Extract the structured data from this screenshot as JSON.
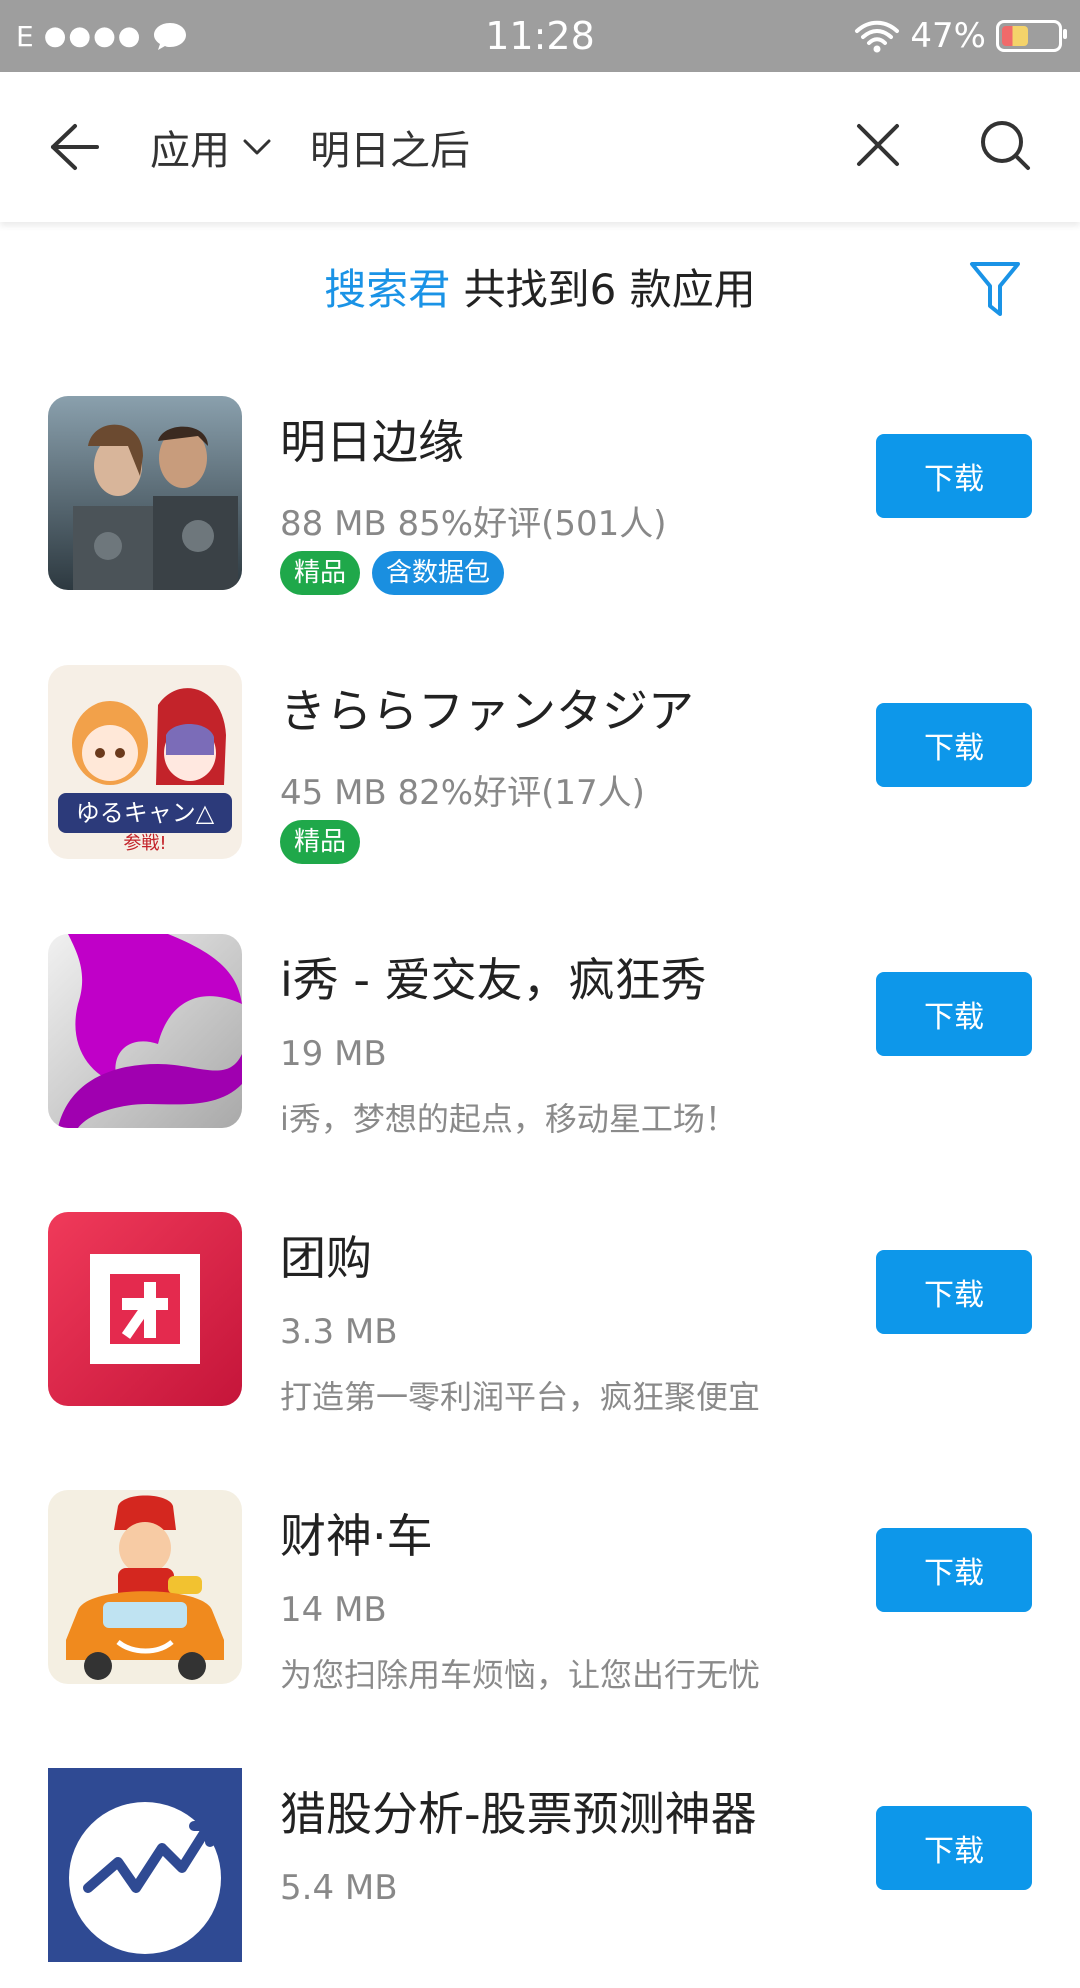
{
  "status_bar": {
    "carrier": "E",
    "signal": "●●●●",
    "time": "11:28",
    "battery": "47%"
  },
  "search": {
    "type_label": "应用",
    "query": "明日之后"
  },
  "summary": {
    "brand": "搜索君",
    "text": " 共找到6 款应用"
  },
  "colors": {
    "accent": "#0d97ea",
    "brand_text": "#1a93e6",
    "tag_green": "#1fa84a",
    "tag_blue": "#1a8fe0"
  },
  "apps": [
    {
      "name": "明日边缘",
      "meta": "88 MB  85%好评(501人)",
      "tags": [
        "精品",
        "含数据包"
      ],
      "button": "下载",
      "icon": "movie-poster-icon"
    },
    {
      "name": "きららファンタジア",
      "meta": "45 MB  82%好评(17人)",
      "tags": [
        "精品"
      ],
      "button": "下载",
      "icon": "anime-characters-icon"
    },
    {
      "name": "i秀 - 爱交友，疯狂秀",
      "meta": "19 MB",
      "desc": "i秀，梦想的起点，移动星工场！",
      "button": "下载",
      "icon": "purple-swirl-icon"
    },
    {
      "name": "团购",
      "meta": "3.3 MB",
      "desc": "打造第一零利润平台，疯狂聚便宜",
      "button": "下载",
      "icon": "tuan-logo-icon"
    },
    {
      "name": "财神·车",
      "meta": "14 MB",
      "desc": "为您扫除用车烦恼，让您出行无忧",
      "button": "下载",
      "icon": "caishen-car-icon"
    },
    {
      "name": "猎股分析-股票预测神器",
      "meta": "5.4 MB",
      "button": "下载",
      "icon": "stock-chart-icon"
    }
  ]
}
